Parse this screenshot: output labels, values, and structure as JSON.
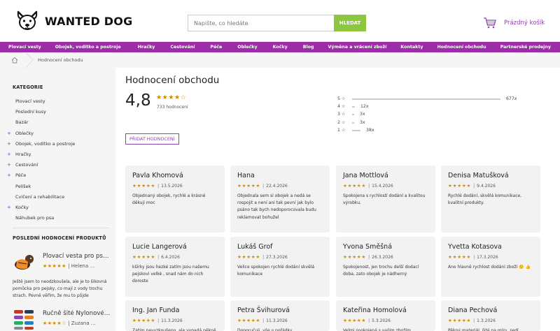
{
  "header": {
    "logo_text": "WANTED DOG",
    "search_placeholder": "Napište, co hledáte",
    "search_button": "HLEDAT",
    "cart_label": "Prázdný košík"
  },
  "nav": {
    "items": [
      "Plovací vesty",
      "Obojek, vodítko a postroje",
      "Hračky",
      "Cestování",
      "Péče",
      "Oblečky",
      "Kočky",
      "Blog",
      "Výměna a vrácení zboží",
      "Kontakty",
      "Hodnocení obchodu",
      "Partnerské prodejny"
    ]
  },
  "breadcrumb": {
    "current": "Hodnocení obchodu"
  },
  "sidebar": {
    "categories_title": "KATEGORIE",
    "categories": [
      {
        "label": "Plovací vesty",
        "expandable": false
      },
      {
        "label": "Poslední kusy",
        "expandable": false
      },
      {
        "label": "Bazár",
        "expandable": false
      },
      {
        "label": "Oblečky",
        "expandable": true
      },
      {
        "label": "Obojek, vodítko a postroje",
        "expandable": true
      },
      {
        "label": "Hračky",
        "expandable": true
      },
      {
        "label": "Cestování",
        "expandable": true
      },
      {
        "label": "Péče",
        "expandable": true
      },
      {
        "label": "Pelíšek",
        "expandable": false
      },
      {
        "label": "Cvičení a rehabilitace",
        "expandable": false
      },
      {
        "label": "Kočky",
        "expandable": true
      },
      {
        "label": "Náhubek pro psa",
        "expandable": false
      }
    ],
    "recent_title": "POSLEDNÍ HODNOCENÍ PRODUKTŮ",
    "recent": [
      {
        "name": "Plovací vesta pro psa...",
        "stars": "★★★★★",
        "author": "Helena ...",
        "text": "Ještě jsem to neodzkoušela, ale je to šikovná pomůcka pro pejsky, co mají z vody trochu strach. Pevně věřím, že mu to půjde"
      },
      {
        "name": "Ručně šité Nylonové ...",
        "stars": "★★★★☆",
        "author": "Zuzana ...",
        "text": ""
      }
    ]
  },
  "main": {
    "title": "Hodnocení obchodu",
    "score": "4,8",
    "score_stars": "★★★★☆",
    "score_count": "733 hodnocení",
    "add_button": "PŘIDAT HODNOCENÍ",
    "distribution": [
      {
        "label": "5 ☆",
        "count": "677x",
        "fraction": 0.922
      },
      {
        "label": "4 ☆",
        "count": "12x",
        "fraction": 0.016
      },
      {
        "label": "3 ☆",
        "count": "3x",
        "fraction": 0.004
      },
      {
        "label": "2 ☆",
        "count": "3x",
        "fraction": 0.004
      },
      {
        "label": "1 ☆",
        "count": "38x",
        "fraction": 0.052
      }
    ],
    "reviews": [
      {
        "name": "Pavla Khomová",
        "stars": "★★★★★",
        "date": "13.5.2026",
        "text": "Objednaný obojek, rychlé a krásné děkuji moc"
      },
      {
        "name": "Hana",
        "stars": "★★★★★",
        "date": "22.4.2026",
        "text": "Objednala sem si obojek a nedá se rospojit a není ani tak pevní jak bylo psáno tak bych nedoporocovala budu reklamovat bohužel"
      },
      {
        "name": "Jana Mottlová",
        "stars": "★★★★★",
        "date": "15.4.2026",
        "text": "Spokojena s rychlostí dodání a kvalitou výrobku."
      },
      {
        "name": "Denisa Matušková",
        "stars": "★★★★★",
        "date": "9.4.2026",
        "text": "Rychlé dodání, skvělá komunikace, kvalitní produkty."
      },
      {
        "name": "Lucie Langerová",
        "stars": "★★★★★",
        "date": "6.4.2026",
        "text": "kšírky jsou hezké zatím jsou našemu pejskovi velké , snad nám do nich doroste"
      },
      {
        "name": "Lukáš Grof",
        "stars": "★★★★★",
        "date": "27.3.2026",
        "text": "Velice spokojen rychlé dodání skvělá komunikace"
      },
      {
        "name": "Yvona Směšná",
        "stars": "★★★★★",
        "date": "26.3.2026",
        "text": "Spokojenost, jen trochu delší dodací doba, zato obojek je nádherný"
      },
      {
        "name": "Yvetta Kotasova",
        "stars": "★★★★★",
        "date": "17.3.2026",
        "text": "Ano hlavně rychlost dodání zboží 🙂 👍"
      },
      {
        "name": "Ing. Jan Funda",
        "stars": "★★★★★",
        "date": "11.3.2026",
        "text": "Zatím nevyzkoušeno, ale vypadá pěkně"
      },
      {
        "name": "Petra Švihurová",
        "stars": "★★★★★",
        "date": "11.3.2026",
        "text": "Doporučuji, vše v pořádku"
      },
      {
        "name": "Kateřina Homolová",
        "stars": "★★★★★",
        "date": "5.3.2026",
        "text": "Velmi spokojená s vaším zbožím"
      },
      {
        "name": "Diana Pechová",
        "stars": "★★★★★",
        "date": "1.3.2026",
        "text": "Pěkný materiál, šité na míru, sedí"
      }
    ]
  },
  "colors": {
    "brand_purple": "#9b2ea8",
    "search_green": "#8dc63f",
    "star_gold": "#d18b00"
  }
}
